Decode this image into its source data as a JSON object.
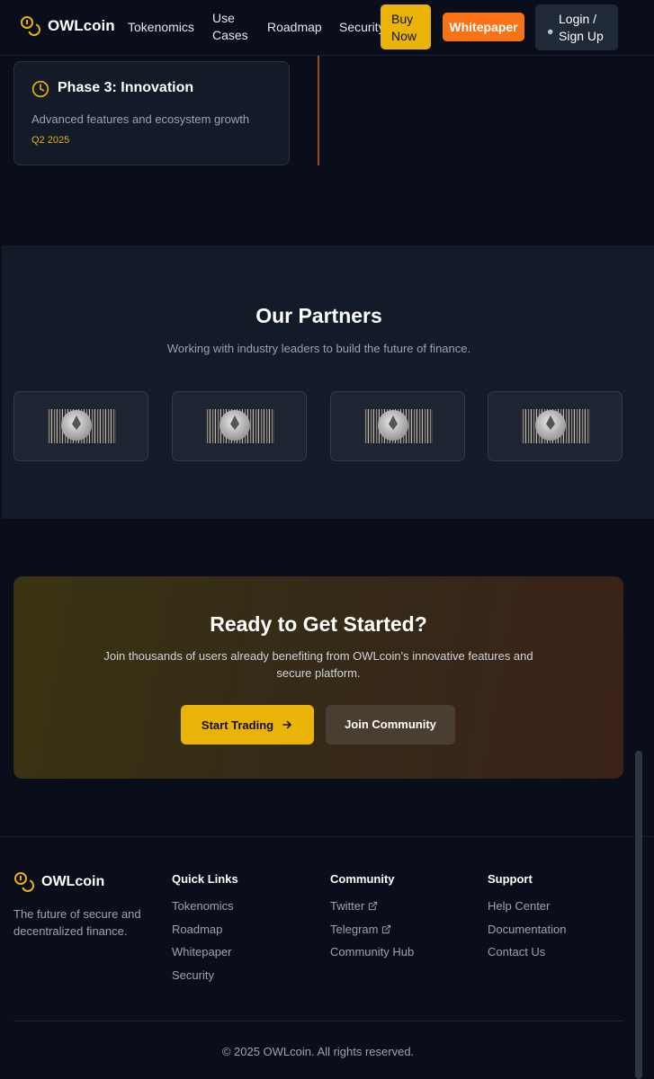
{
  "nav": {
    "brand": "OWLcoin",
    "links": [
      "Tokenomics",
      "Use\nCases",
      "Roadmap",
      "Security"
    ],
    "buy_now": "Buy\nNow",
    "whitepaper": "Whitepaper",
    "login": "Login /\nSign Up",
    "colors": {
      "accent": "#eab308",
      "orange": "#f97316"
    }
  },
  "roadmap": {
    "phase_title": "Phase 3: Innovation",
    "phase_desc": "Advanced features and ecosystem growth",
    "phase_date": "Q2 2025",
    "icon": "clock-icon"
  },
  "partners": {
    "title": "Our Partners",
    "subtitle": "Working with industry leaders to build the future of finance.",
    "logos": [
      "ethereum-coin-image",
      "ethereum-coin-image",
      "ethereum-coin-image",
      "ethereum-coin-image"
    ]
  },
  "cta": {
    "title": "Ready to Get Started?",
    "text": "Join thousands of users already benefiting from OWLcoin's innovative features and secure platform.",
    "start_trading": "Start Trading",
    "join_community": "Join Community"
  },
  "footer": {
    "brand": "OWLcoin",
    "tagline": "The future of secure and decentralized finance.",
    "quick_links": {
      "title": "Quick Links",
      "items": [
        "Tokenomics",
        "Roadmap",
        "Whitepaper",
        "Security"
      ]
    },
    "community": {
      "title": "Community",
      "items": [
        "Twitter",
        "Telegram",
        "Community Hub"
      ]
    },
    "support": {
      "title": "Support",
      "items": [
        "Help Center",
        "Documentation",
        "Contact Us"
      ]
    },
    "copyright": "© 2025 OWLcoin. All rights reserved."
  }
}
